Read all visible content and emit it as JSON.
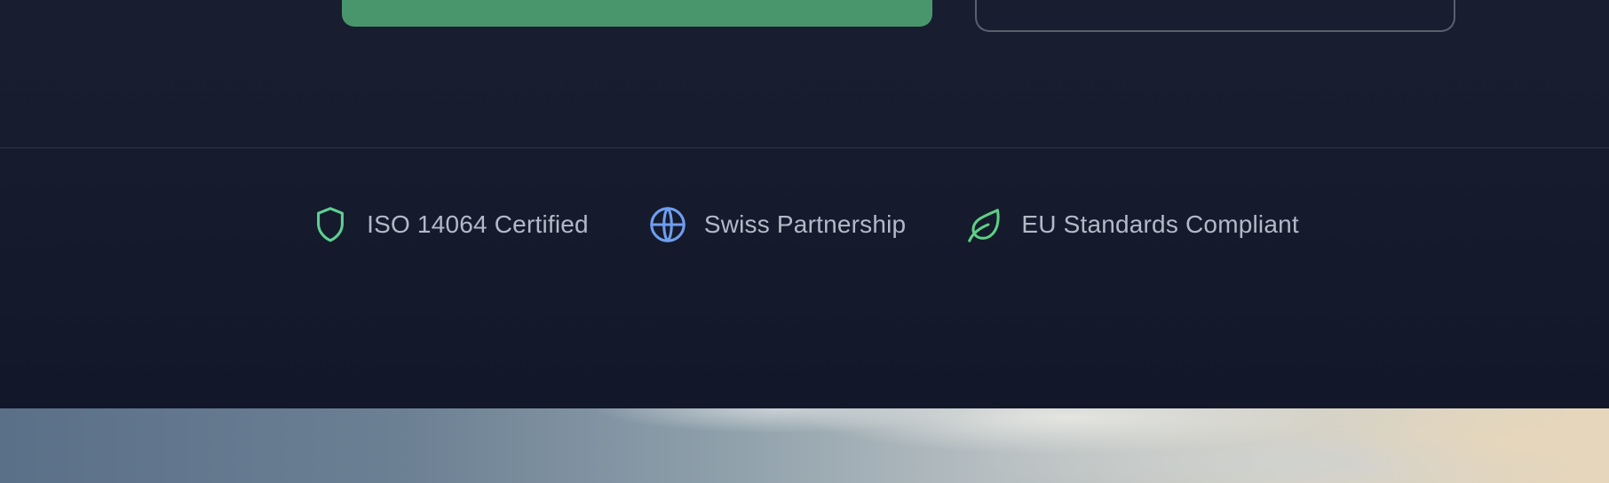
{
  "trust_badges": [
    {
      "icon": "shield-icon",
      "label": "ISO 14064 Certified",
      "color": "#5fcf92"
    },
    {
      "icon": "globe-icon",
      "label": "Swiss Partnership",
      "color": "#6f9ef0"
    },
    {
      "icon": "leaf-icon",
      "label": "EU Standards Compliant",
      "color": "#5fcf85"
    }
  ],
  "colors": {
    "background": "#161c2e",
    "primary_button": "#4a966c",
    "secondary_button_border": "#5a5f6e",
    "label_text": "#b3b9c6"
  }
}
